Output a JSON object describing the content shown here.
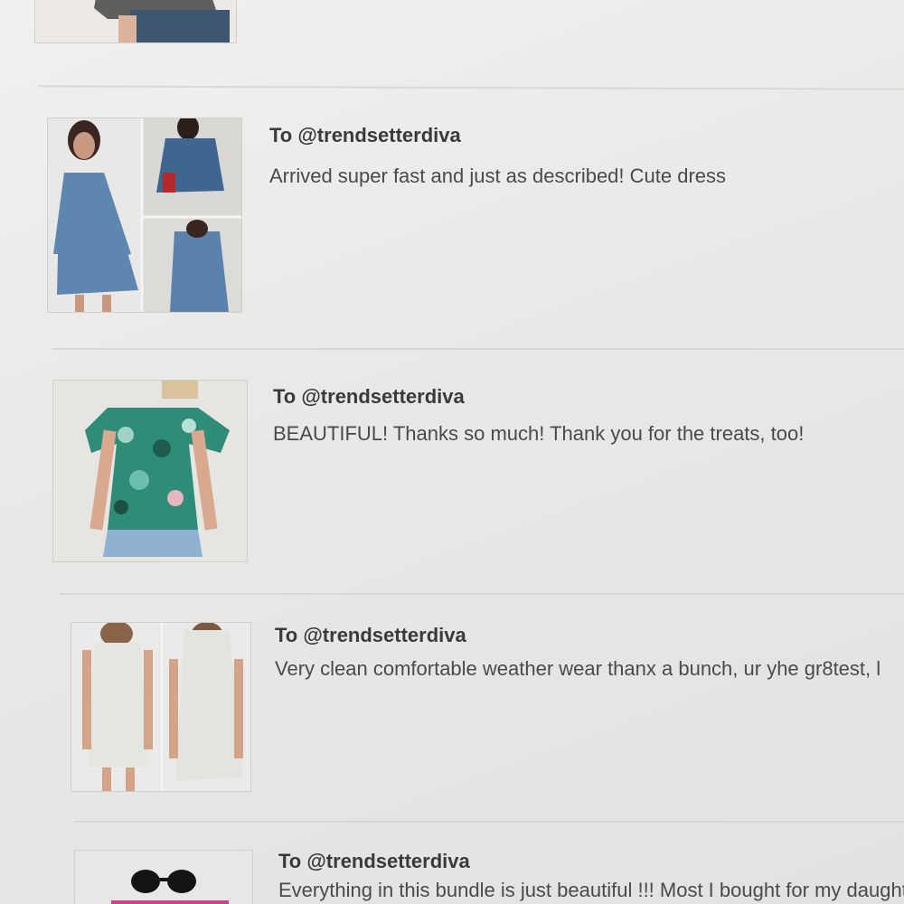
{
  "feedback": [
    {
      "recipient": "",
      "message": "",
      "thumbnail": "woman-in-dark-top-jeans-photo"
    },
    {
      "recipient": "To @trendsetterdiva",
      "message": "Arrived super fast and just as described! Cute dress",
      "thumbnail": "denim-dress-collage-photo"
    },
    {
      "recipient": "To @trendsetterdiva",
      "message": "BEAUTIFUL! Thanks so much! Thank you for the treats, too!",
      "thumbnail": "tropical-off-shoulder-top-photo"
    },
    {
      "recipient": "To @trendsetterdiva",
      "message": "Very clean comfortable weather wear thanx a bunch, ur yhe gr8test, l",
      "thumbnail": "white-hooded-dress-photo"
    },
    {
      "recipient": "To @trendsetterdiva",
      "message": "Everything in this bundle is just beautiful !!! Most I bought for my daught",
      "thumbnail": "sunglasses-bundle-photo"
    }
  ],
  "colors": {
    "background": "#ecebea",
    "divider": "#d9d8d5",
    "username": "#3a3a3a",
    "message": "#4a4a4a"
  }
}
